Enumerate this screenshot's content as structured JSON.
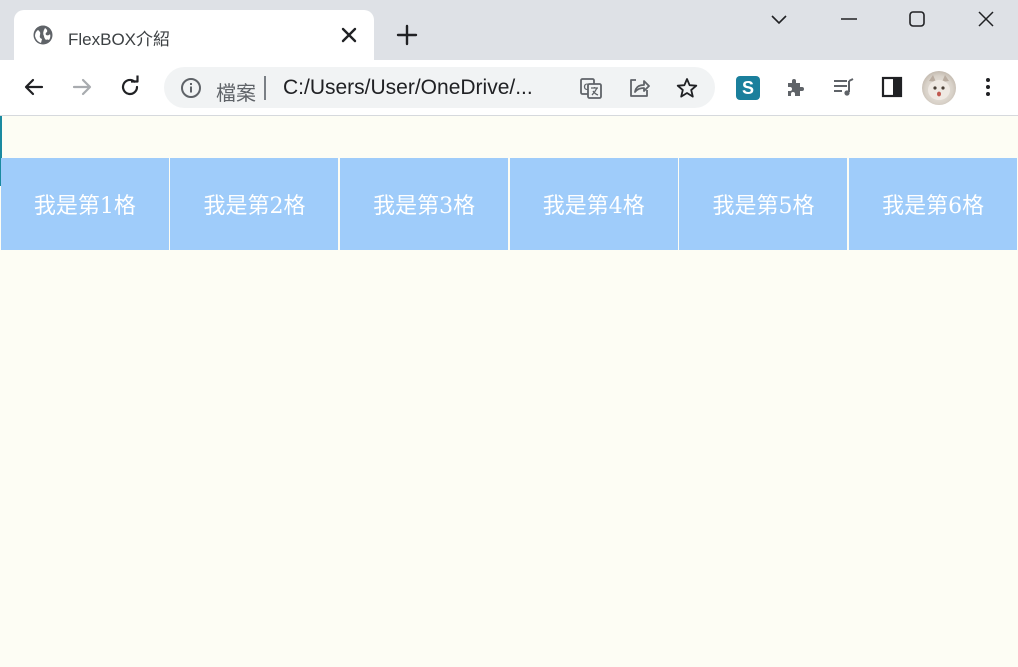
{
  "browser": {
    "tab": {
      "title": "FlexBOX介紹",
      "favicon": "globe-icon"
    },
    "address_bar": {
      "security_label": "檔案",
      "url": "C:/Users/User/OneDrive/..."
    },
    "extension_letter": "S"
  },
  "page": {
    "background": "#fdfdf4",
    "cell_color": "#9fccfa",
    "cells": [
      {
        "label": "我是第1格"
      },
      {
        "label": "我是第2格"
      },
      {
        "label": "我是第3格"
      },
      {
        "label": "我是第4格"
      },
      {
        "label": "我是第5格"
      },
      {
        "label": "我是第6格"
      }
    ]
  }
}
